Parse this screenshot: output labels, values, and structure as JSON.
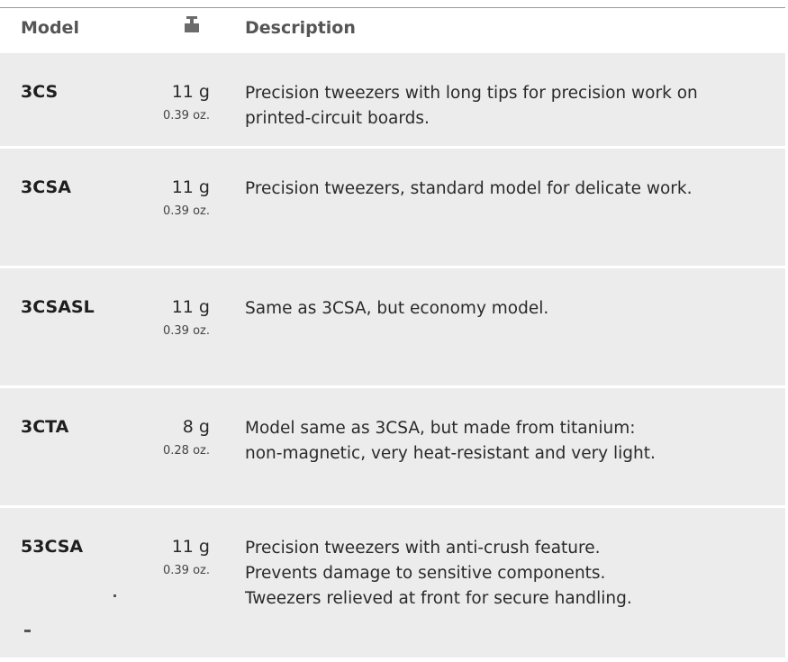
{
  "header": {
    "model_label": "Model",
    "weight_icon": "weight-icon",
    "description_label": "Description"
  },
  "rows": [
    {
      "model": "3CS",
      "grams": "11 g",
      "ounces": "0.39 oz.",
      "description": [
        "Precision tweezers with long tips for precision work on",
        "printed-circuit boards."
      ]
    },
    {
      "model": "3CSA",
      "grams": "11 g",
      "ounces": "0.39 oz.",
      "description": [
        "Precision tweezers, standard model for delicate work."
      ]
    },
    {
      "model": "3CSASL",
      "grams": "11 g",
      "ounces": "0.39 oz.",
      "description": [
        "Same as 3CSA, but economy model."
      ]
    },
    {
      "model": "3CTA",
      "grams": "8 g",
      "ounces": "0.28 oz.",
      "description": [
        "Model same as 3CSA, but made from titanium:",
        "non-magnetic, very heat-resistant and very light."
      ]
    },
    {
      "model": "53CSA",
      "grams": "11 g",
      "ounces": "0.39 oz.",
      "description": [
        "Precision tweezers with anti-crush feature.",
        "Prevents damage to sensitive components.",
        "Tweezers relieved at front for secure handling."
      ]
    }
  ],
  "colors": {
    "row_background": "#ececec",
    "header_text": "#555555",
    "body_text": "#2a2a2a"
  }
}
